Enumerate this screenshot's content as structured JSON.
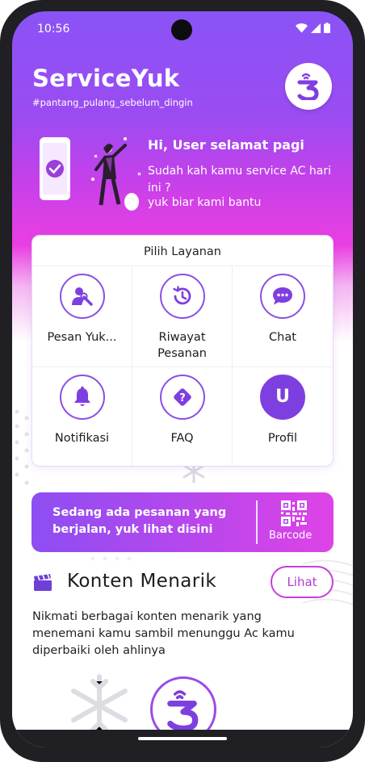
{
  "status_bar": {
    "time": "10:56"
  },
  "header": {
    "app_name": "ServiceYuk",
    "tagline": "#pantang_pulang_sebelum_dingin",
    "logo_icon": "serviceyuk-logo-icon"
  },
  "greeting": {
    "title": "Hi, User selamat pagi",
    "line1": "Sudah kah kamu service AC hari ini ?",
    "line2": "yuk biar kami bantu"
  },
  "services": {
    "title": "Pilih Layanan",
    "items": [
      {
        "label": "Pesan Yuk...",
        "icon": "user-wrench-icon"
      },
      {
        "label": "Riwayat Pesanan",
        "icon": "history-icon"
      },
      {
        "label": "Chat",
        "icon": "chat-bubble-icon"
      },
      {
        "label": "Notifikasi",
        "icon": "bell-icon"
      },
      {
        "label": "FAQ",
        "icon": "question-diamond-icon"
      },
      {
        "label": "Profil",
        "icon": "profile-avatar",
        "avatar_letter": "U"
      }
    ]
  },
  "order_banner": {
    "text": "Sedang ada pesanan yang berjalan, yuk lihat disini",
    "barcode_label": "Barcode",
    "icon": "qr-code-icon"
  },
  "content_section": {
    "title": "Konten Menarik",
    "button_label": "Lihat",
    "description": "Nikmati berbagai konten menarik yang menemani kamu sambil menunggu Ac kamu diperbaiki oleh ahlinya",
    "icon": "video-clapper-icon"
  },
  "colors": {
    "primary_purple": "#8a53f6",
    "magenta": "#ea3fe2",
    "accent_text": "#b23ad0"
  }
}
